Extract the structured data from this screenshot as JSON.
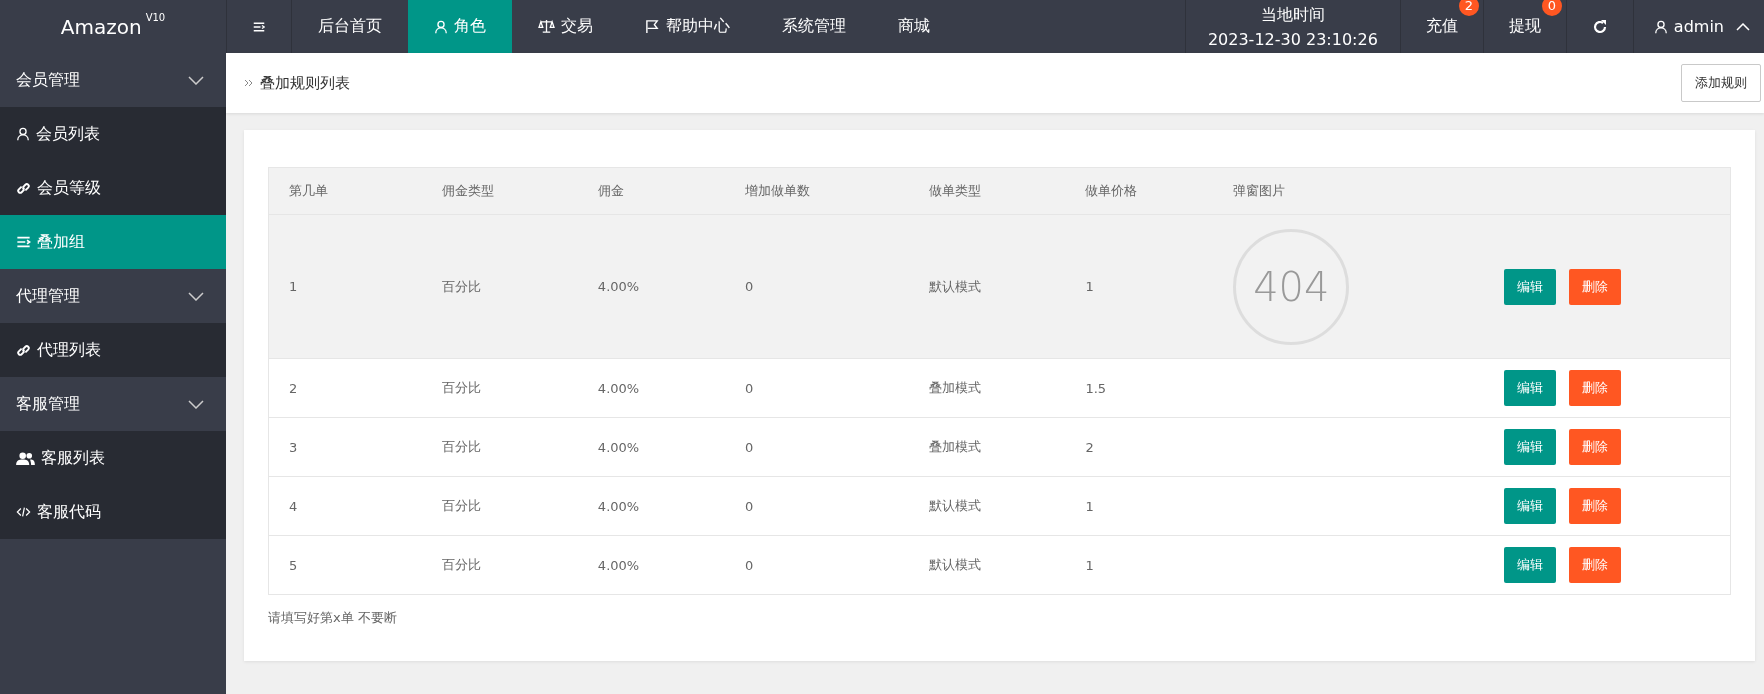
{
  "header": {
    "logo": "Amazon",
    "version": "V10",
    "nav": [
      {
        "label": "后台首页",
        "selected": false
      },
      {
        "label": "角色",
        "selected": true
      },
      {
        "label": "交易",
        "selected": false
      },
      {
        "label": "帮助中心",
        "selected": false
      },
      {
        "label": "系统管理",
        "selected": false
      },
      {
        "label": "商城",
        "selected": false
      }
    ],
    "time_label": "当地时间",
    "time": "2023-12-30 23:10:26",
    "actions": [
      {
        "label": "充值",
        "badge": "2"
      },
      {
        "label": "提现",
        "badge": "0"
      }
    ],
    "user": "admin"
  },
  "sidebar": [
    {
      "label": "会员管理",
      "expanded": true,
      "children": [
        {
          "label": "会员列表",
          "selected": false
        },
        {
          "label": "会员等级",
          "selected": false
        },
        {
          "label": "叠加组",
          "selected": true
        }
      ]
    },
    {
      "label": "代理管理",
      "expanded": true,
      "children": [
        {
          "label": "代理列表",
          "selected": false
        }
      ]
    },
    {
      "label": "客服管理",
      "expanded": true,
      "children": [
        {
          "label": "客服列表",
          "selected": false
        },
        {
          "label": "客服代码",
          "selected": false
        }
      ]
    }
  ],
  "breadcrumb": "叠加规则列表",
  "add_button": "添加规则",
  "table": {
    "columns": [
      "第几单",
      "佣金类型",
      "佣金",
      "增加做单数",
      "做单类型",
      "做单价格",
      "弹窗图片"
    ],
    "rows": [
      {
        "cells": [
          "1",
          "百分比",
          "4.00%",
          "0",
          "默认模式",
          "1"
        ],
        "image": "404",
        "edit": "编辑",
        "delete": "删除"
      },
      {
        "cells": [
          "2",
          "百分比",
          "4.00%",
          "0",
          "叠加模式",
          "1.5"
        ],
        "edit": "编辑",
        "delete": "删除"
      },
      {
        "cells": [
          "3",
          "百分比",
          "4.00%",
          "0",
          "叠加模式",
          "2"
        ],
        "edit": "编辑",
        "delete": "删除"
      },
      {
        "cells": [
          "4",
          "百分比",
          "4.00%",
          "0",
          "默认模式",
          "1"
        ],
        "edit": "编辑",
        "delete": "删除"
      },
      {
        "cells": [
          "5",
          "百分比",
          "4.00%",
          "0",
          "默认模式",
          "1"
        ],
        "edit": "编辑",
        "delete": "删除"
      }
    ]
  },
  "note": "请填写好第x单 不要断"
}
